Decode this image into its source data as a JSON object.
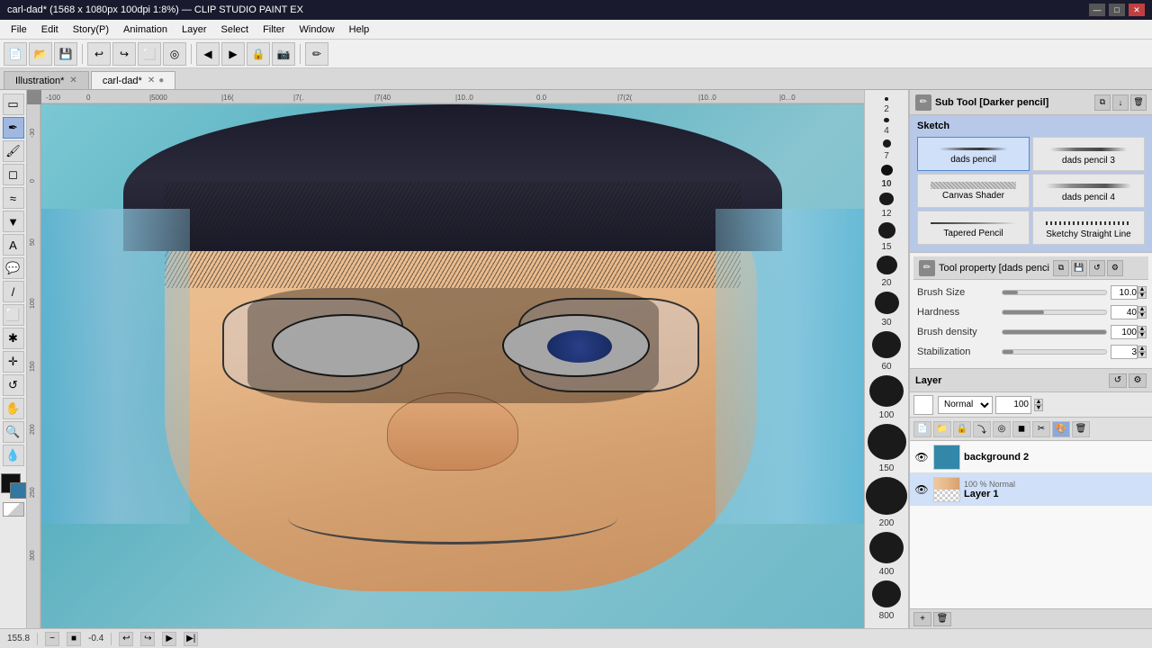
{
  "titlebar": {
    "title": "carl-dad* (1568 x 1080px 100dpi 1:8%) — CLIP STUDIO PAINT EX",
    "minimize": "—",
    "maximize": "□",
    "close": "✕"
  },
  "menubar": {
    "items": [
      "File",
      "Edit",
      "Story(P)",
      "Animation",
      "Layer",
      "Select",
      "Filter",
      "Window",
      "Help"
    ]
  },
  "tabs": [
    {
      "label": "Illustration*",
      "active": false
    },
    {
      "label": "carl-dad*",
      "active": true
    }
  ],
  "subtool": {
    "title": "Sub Tool [Darker pencil]",
    "icon": "✏"
  },
  "sketch_section": {
    "label": "Sketch",
    "brushes": [
      {
        "name": "dads pencil",
        "type": "pencil"
      },
      {
        "name": "dads pencil 3",
        "type": "pencil3"
      },
      {
        "name": "Canvas Shader",
        "type": "canvas"
      },
      {
        "name": "dads pencil 4",
        "type": "pencil4"
      },
      {
        "name": "Tapered Pencil",
        "type": "tapered"
      },
      {
        "name": "Sketchy Straight Line",
        "type": "sketchy"
      }
    ]
  },
  "tool_property": {
    "title": "Tool property [dads penci",
    "brush_size": {
      "label": "Brush Size",
      "value": "10.0",
      "pct": 15
    },
    "hardness": {
      "label": "Hardness",
      "value": "40",
      "pct": 40
    },
    "brush_density": {
      "label": "Brush density",
      "value": "100",
      "pct": 100
    },
    "stabilization": {
      "label": "Stabilization",
      "value": "3",
      "pct": 10
    }
  },
  "layer_panel": {
    "title": "Layer",
    "blend_mode": "Normal",
    "opacity": "100",
    "layers": [
      {
        "name": "background 2",
        "sub": "",
        "visible": true,
        "type": "color"
      },
      {
        "name": "Layer 1",
        "sub": "100 % Normal",
        "visible": true,
        "type": "checker"
      }
    ]
  },
  "brush_sizes": [
    {
      "size": 4,
      "label": "2"
    },
    {
      "size": 6,
      "label": "4"
    },
    {
      "size": 9,
      "label": "7"
    },
    {
      "size": 13,
      "label": "10"
    },
    {
      "size": 16,
      "label": "12"
    },
    {
      "size": 19,
      "label": "15"
    },
    {
      "size": 23,
      "label": "20"
    },
    {
      "size": 27,
      "label": "30"
    },
    {
      "size": 33,
      "label": "60"
    },
    {
      "size": 38,
      "label": "100"
    },
    {
      "size": 43,
      "label": "150"
    },
    {
      "size": 48,
      "label": "200"
    },
    {
      "size": 40,
      "label": "400"
    },
    {
      "size": 35,
      "label": "800"
    }
  ],
  "statusbar": {
    "coords": "155.8",
    "zoom": "-0.4",
    "nav_prev": "◀",
    "nav_next": "▶"
  },
  "colors": {
    "fg": "#111111",
    "bg": "#3378a0",
    "accent": "#a0b8e0"
  }
}
